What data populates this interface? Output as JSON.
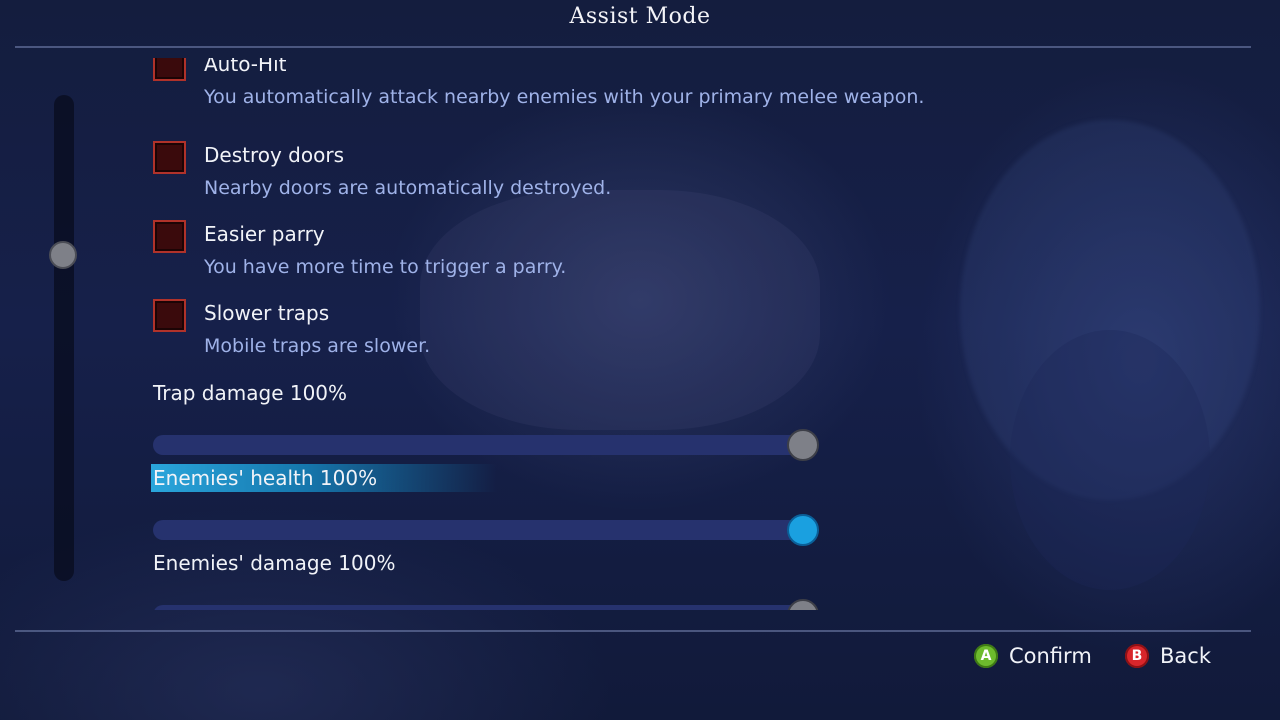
{
  "header": {
    "title": "Assist Mode"
  },
  "options": [
    {
      "label": "Auto-Hit",
      "description": "You automatically attack nearby enemies with your primary melee weapon.",
      "checked": false
    },
    {
      "label": "Destroy doors",
      "description": "Nearby doors are automatically destroyed.",
      "checked": false
    },
    {
      "label": "Easier parry",
      "description": "You have more time to trigger a parry.",
      "checked": false
    },
    {
      "label": "Slower traps",
      "description": "Mobile traps are slower.",
      "checked": false
    }
  ],
  "sliders": [
    {
      "label": "Trap damage 100%",
      "value_percent": 100,
      "focused": false
    },
    {
      "label": "Enemies' health 100%",
      "value_percent": 100,
      "focused": true
    },
    {
      "label": "Enemies' damage 100%",
      "value_percent": 100,
      "focused": false
    }
  ],
  "footer": {
    "confirm_button": "A",
    "confirm_label": "Confirm",
    "back_button": "B",
    "back_label": "Back"
  },
  "colors": {
    "checkbox_border": "#b0322a",
    "slider_track": "#26326e",
    "focus_highlight": "#2aa6dc",
    "a_button": "#6dbb2d",
    "b_button": "#d8262b"
  }
}
